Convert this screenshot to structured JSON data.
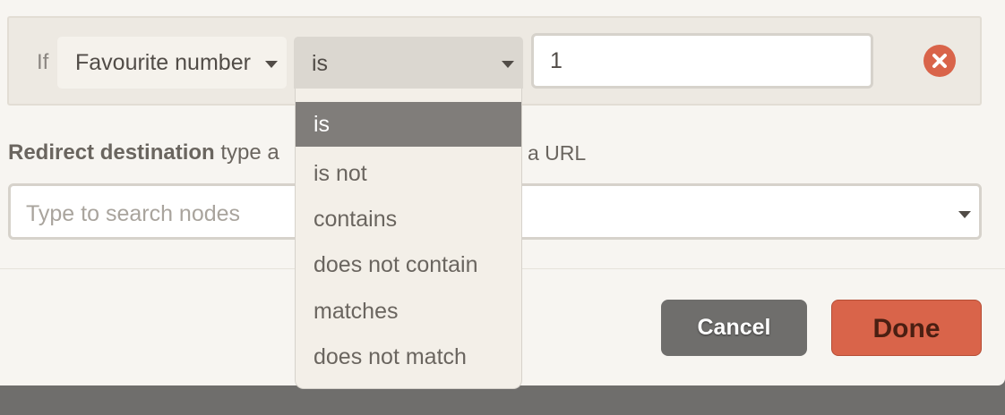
{
  "rule": {
    "if_label": "If",
    "field": "Favourite number",
    "operator": "is",
    "value": "1"
  },
  "redirect": {
    "label_bold": "Redirect destination",
    "label_rest": "type a",
    "label_tail": "a URL",
    "search_placeholder": "Type to search nodes"
  },
  "operator_options": [
    "is",
    "is not",
    "contains",
    "does not contain",
    "matches",
    "does not match"
  ],
  "selected_operator_index": 0,
  "buttons": {
    "cancel": "Cancel",
    "done": "Done"
  },
  "icons": {
    "remove": "remove-icon",
    "caret": "chevron-down-icon"
  },
  "colors": {
    "accent": "#d9644a",
    "neutral_button": "#6f6e6c",
    "selected_option": "#807d7a"
  }
}
